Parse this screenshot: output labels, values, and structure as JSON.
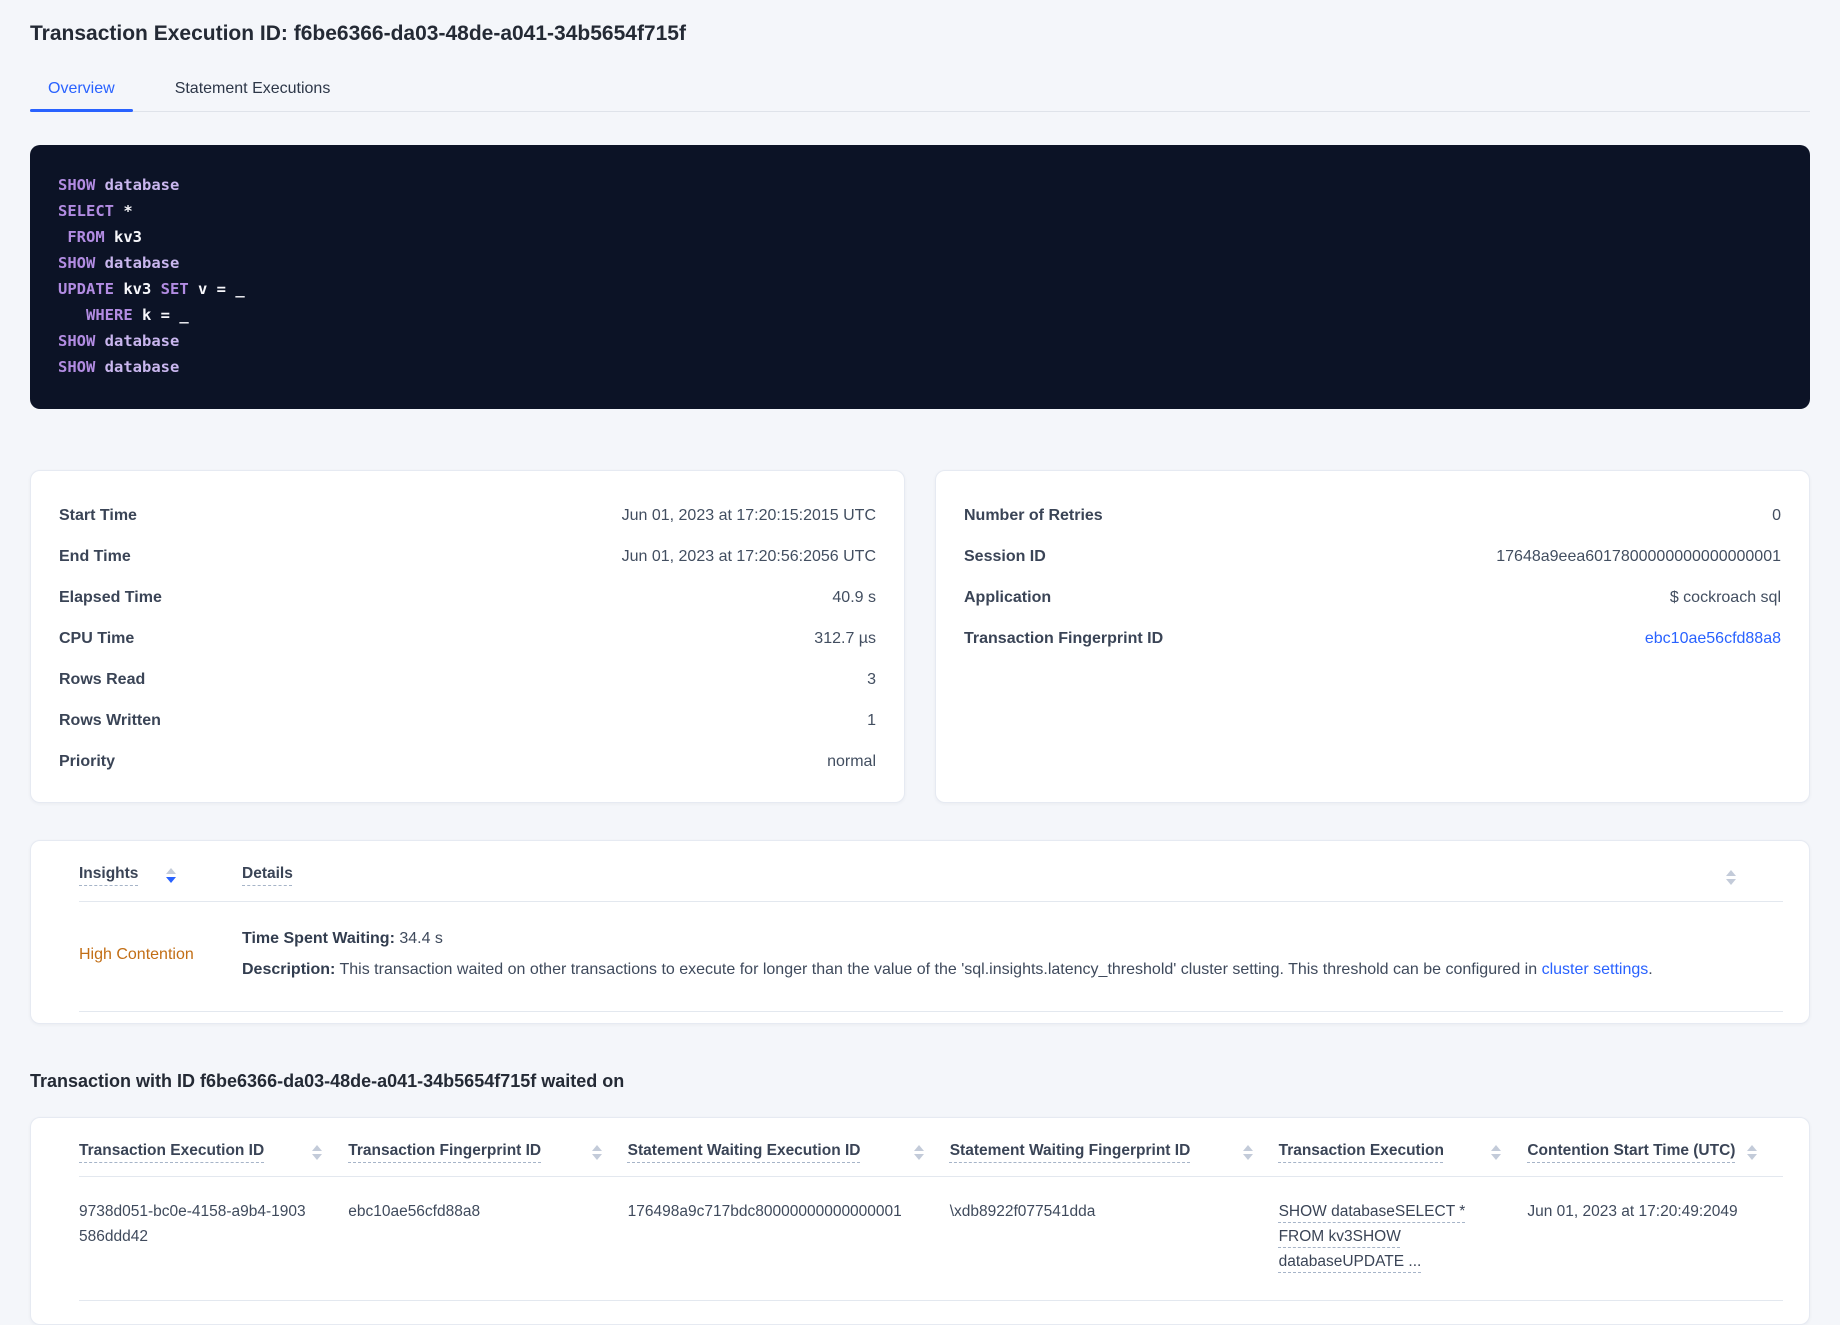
{
  "page": {
    "title": "Transaction Execution ID: f6be6366-da03-48de-a041-34b5654f715f"
  },
  "colors": {
    "accent_blue": "#2962ff",
    "high_contention_orange": "#c26e15",
    "code_background": "#0c1326",
    "code_keyword": "#b28ce2",
    "page_background": "#f4f6fa"
  },
  "tabs": {
    "overview": "Overview",
    "statement_executions": "Statement Executions"
  },
  "sql_statements": {
    "lines": [
      [
        [
          "kw",
          "SHOW"
        ],
        [
          "db",
          " database"
        ]
      ],
      [
        [
          "kw",
          "SELECT"
        ],
        [
          "pl",
          " *"
        ]
      ],
      [
        [
          "pl",
          " "
        ],
        [
          "kw",
          "FROM"
        ],
        [
          "pl",
          " kv3"
        ]
      ],
      [
        [
          "kw",
          "SHOW"
        ],
        [
          "db",
          " database"
        ]
      ],
      [
        [
          "kw",
          "UPDATE"
        ],
        [
          "pl",
          " kv3 "
        ],
        [
          "kw",
          "SET"
        ],
        [
          "pl",
          " v = _"
        ]
      ],
      [
        [
          "pl",
          "   "
        ],
        [
          "kw",
          "WHERE"
        ],
        [
          "pl",
          " k = _"
        ]
      ],
      [
        [
          "kw",
          "SHOW"
        ],
        [
          "db",
          " database"
        ]
      ],
      [
        [
          "kw",
          "SHOW"
        ],
        [
          "db",
          " database"
        ]
      ]
    ]
  },
  "overview_card": {
    "rows": [
      {
        "label": "Start Time",
        "value": "Jun 01, 2023 at 17:20:15:2015 UTC"
      },
      {
        "label": "End Time",
        "value": "Jun 01, 2023 at 17:20:56:2056 UTC"
      },
      {
        "label": "Elapsed Time",
        "value": "40.9 s"
      },
      {
        "label": "CPU Time",
        "value": "312.7 µs"
      },
      {
        "label": "Rows Read",
        "value": "3"
      },
      {
        "label": "Rows Written",
        "value": "1"
      },
      {
        "label": "Priority",
        "value": "normal"
      }
    ]
  },
  "session_card": {
    "rows": [
      {
        "label": "Number of Retries",
        "value": "0"
      },
      {
        "label": "Session ID",
        "value": "17648a9eea6017800000000000000001"
      },
      {
        "label": "Application",
        "value": "$ cockroach sql"
      },
      {
        "label": "Transaction Fingerprint ID",
        "value": "ebc10ae56cfd88a8"
      }
    ]
  },
  "insights": {
    "columns": {
      "insights": "Insights",
      "details": "Details"
    },
    "row": {
      "insight": "High Contention",
      "waiting_label": "Time Spent Waiting:",
      "waiting_value": " 34.4 s",
      "description_label": "Description:",
      "description_text": " This transaction waited on other transactions to execute for longer than the value of the 'sql.insights.latency_threshold' cluster setting. This threshold can be configured in ",
      "description_link": "cluster settings",
      "description_suffix": "."
    }
  },
  "waited_on": {
    "heading": "Transaction with ID f6be6366-da03-48de-a041-34b5654f715f waited on",
    "columns": [
      "Transaction Execution ID",
      "Transaction Fingerprint ID",
      "Statement Waiting Execution ID",
      "Statement Waiting Fingerprint ID",
      "Transaction Execution",
      "Contention Start Time (UTC)"
    ],
    "row": {
      "transaction_execution_id": "9738d051-bc0e-4158-a9b4-1903586ddd42",
      "transaction_fingerprint_id": "ebc10ae56cfd88a8",
      "statement_waiting_execution_id": "176498a9c717bdc80000000000000001",
      "statement_waiting_fingerprint_id": "\\xdb8922f077541dda",
      "transaction_execution": "SHOW databaseSELECT * FROM kv3SHOW databaseUPDATE ...",
      "contention_start_time": "Jun 01, 2023 at 17:20:49:2049"
    }
  }
}
